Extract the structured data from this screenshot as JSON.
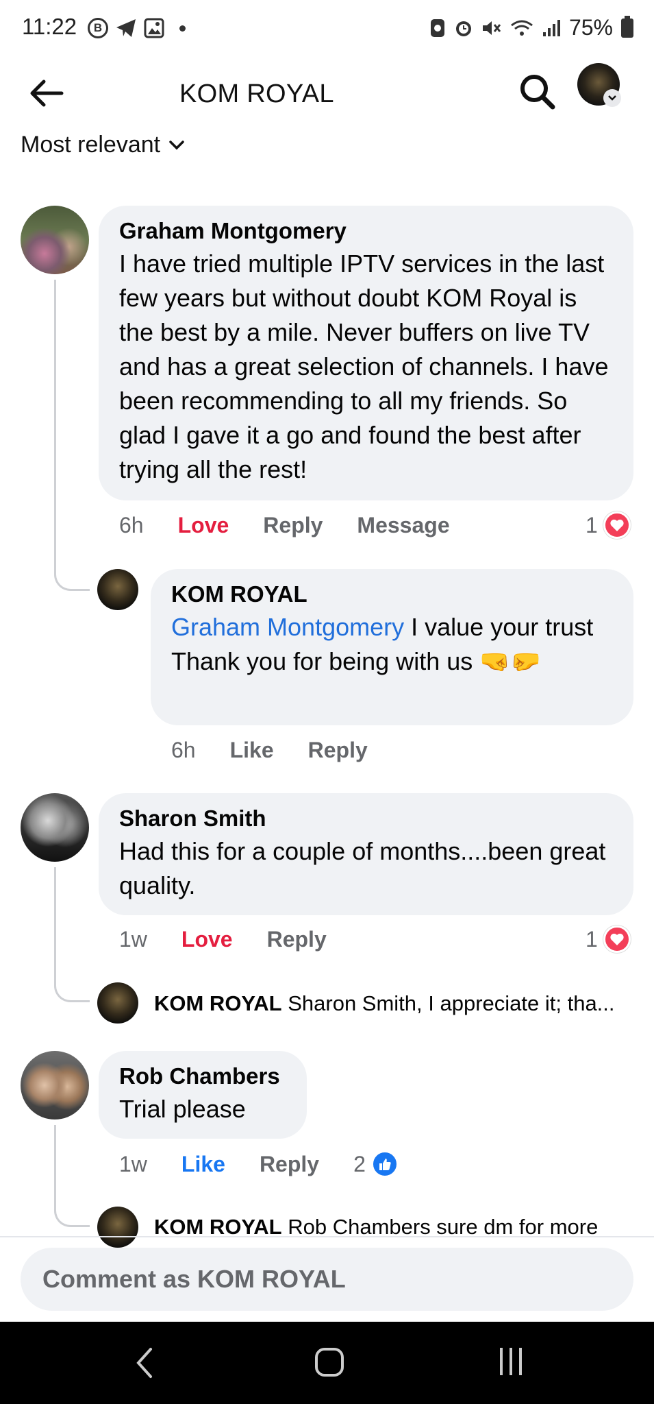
{
  "status_bar": {
    "time": "11:22",
    "battery": "75%"
  },
  "header": {
    "title": "KOM ROYAL"
  },
  "sort": {
    "label": "Most relevant"
  },
  "comments": [
    {
      "author": "Graham Montgomery",
      "text": "I have tried multiple IPTV services in the last few years but without doubt KOM Royal is the best by a mile. Never buffers on live TV and has a great selection of channels. I have been recommending to all my friends. So glad I gave it a go and found the best after trying all the rest!",
      "time": "6h",
      "reaction_action": "Love",
      "reply_label": "Reply",
      "message_label": "Message",
      "reaction_count": "1",
      "reaction_type": "heart-icon",
      "reply": {
        "author": "KOM ROYAL",
        "mention": "Graham Montgomery",
        "text_line1": " I value your trust",
        "text_line2": "Thank you for being with us 🤜🤛",
        "time": "6h",
        "like_label": "Like",
        "reply_label": "Reply"
      }
    },
    {
      "author": "Sharon Smith",
      "text": "Had this for a couple of months....been great quality.",
      "time": "1w",
      "reaction_action": "Love",
      "reply_label": "Reply",
      "reaction_count": "1",
      "reaction_type": "heart-icon",
      "reply_preview": {
        "author": "KOM ROYAL",
        "text": "Sharon Smith, I appreciate it; tha..."
      }
    },
    {
      "author": "Rob Chambers",
      "text": "Trial please",
      "time": "1w",
      "reaction_action": "Like",
      "reply_label": "Reply",
      "reaction_count": "2",
      "reaction_type": "like-icon",
      "reply_preview": {
        "author": "KOM ROYAL",
        "text": "Rob Chambers sure dm for more"
      }
    }
  ],
  "composer": {
    "placeholder": "Comment as KOM ROYAL"
  },
  "colors": {
    "love": "#e41e3f",
    "like": "#1877f2",
    "bubble": "#f0f2f5",
    "mention": "#216fdb"
  }
}
